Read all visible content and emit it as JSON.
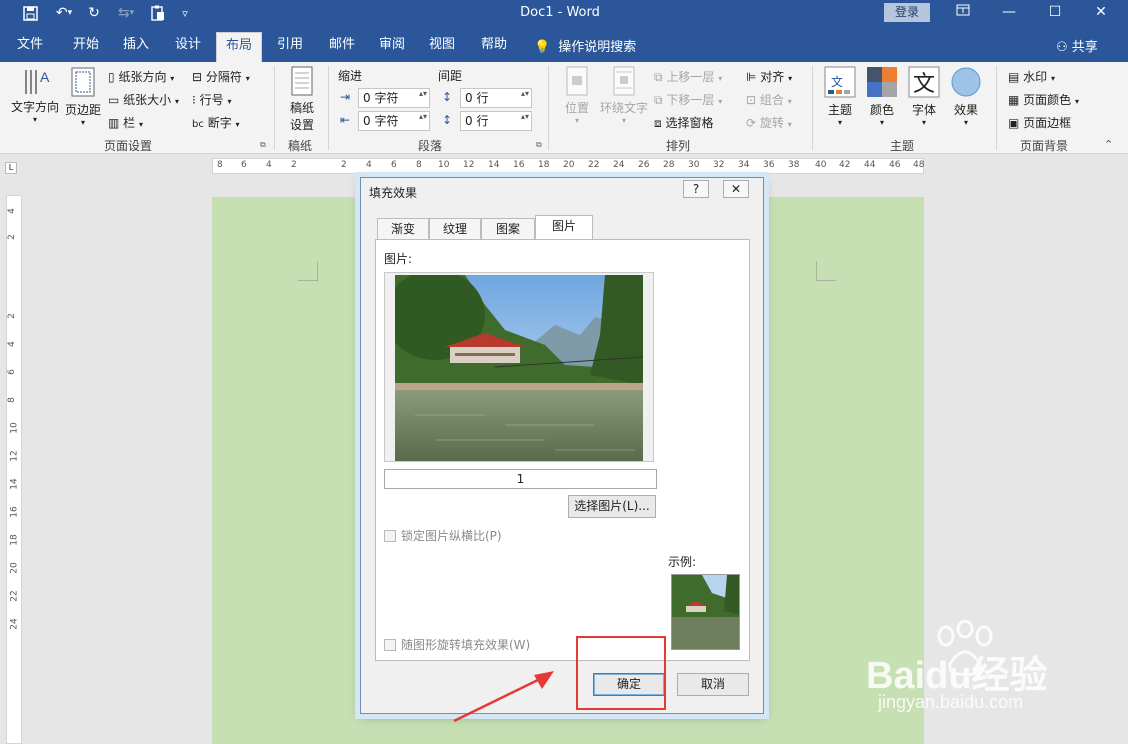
{
  "titlebar": {
    "doc_title": "Doc1  -  Word",
    "login": "登录",
    "icons": [
      "save-icon",
      "undo-icon",
      "redo-icon",
      "paste-icon",
      "customize-icon"
    ]
  },
  "tabs": [
    "文件",
    "开始",
    "插入",
    "设计",
    "布局",
    "引用",
    "邮件",
    "审阅",
    "视图",
    "帮助"
  ],
  "active_tab": "布局",
  "tell_me": "操作说明搜索",
  "share": "共享",
  "ribbon": {
    "page_setup": {
      "text_direction": "文字方向",
      "margins": "页边距",
      "orientation": "纸张方向",
      "size": "纸张大小",
      "columns": "栏",
      "breaks": "分隔符",
      "line_numbers": "行号",
      "hyphenation": "断字",
      "group": "页面设置"
    },
    "draft": {
      "label_line1": "稿纸",
      "label_line2": "设置",
      "group": "稿纸"
    },
    "paragraph": {
      "indent": "缩进",
      "spacing": "间距",
      "indent_left": "0 字符",
      "indent_right": "0 字符",
      "spacing_before": "0 行",
      "spacing_after": "0 行",
      "group": "段落"
    },
    "arrange": {
      "position": "位置",
      "wrap_text": "环绕文字",
      "bring_forward": "上移一层",
      "send_backward": "下移一层",
      "selection_pane": "选择窗格",
      "align": "对齐",
      "group_objects": "组合",
      "rotate": "旋转",
      "group": "排列"
    },
    "themes": {
      "themes": "主题",
      "colors": "颜色",
      "fonts": "字体",
      "effects": "效果",
      "group": "主题"
    },
    "page_background": {
      "watermark": "水印",
      "page_color": "页面颜色",
      "page_borders": "页面边框",
      "group": "页面背景"
    }
  },
  "ruler_numbers": [
    "8",
    "6",
    "4",
    "2",
    "2",
    "4",
    "6",
    "8",
    "10",
    "12",
    "14",
    "16",
    "18",
    "20",
    "22",
    "24",
    "26",
    "28",
    "30",
    "32",
    "34",
    "36",
    "38",
    "40",
    "42",
    "44",
    "46",
    "48"
  ],
  "vruler_numbers": [
    "4",
    "2",
    "2",
    "4",
    "6",
    "8",
    "10",
    "12",
    "14",
    "16",
    "18",
    "20",
    "22",
    "24"
  ],
  "dialog": {
    "title": "填充效果",
    "help": "?",
    "close": "✕",
    "tabs": [
      "渐变",
      "纹理",
      "图案",
      "图片"
    ],
    "active_tab": "图片",
    "picture_label": "图片:",
    "picture_name": "1",
    "select_picture": "选择图片(L)...",
    "lock_aspect": "锁定图片纵横比(P)",
    "sample_label": "示例:",
    "rotate_with_shape": "随图形旋转填充效果(W)",
    "ok": "确定",
    "cancel": "取消"
  },
  "watermark_text": {
    "brand": "Baidu经验",
    "url": "jingyan.baidu.com"
  },
  "colors": {
    "word_blue": "#2b579a",
    "page_green": "#c6e0b4",
    "highlight_red": "#e53935"
  }
}
